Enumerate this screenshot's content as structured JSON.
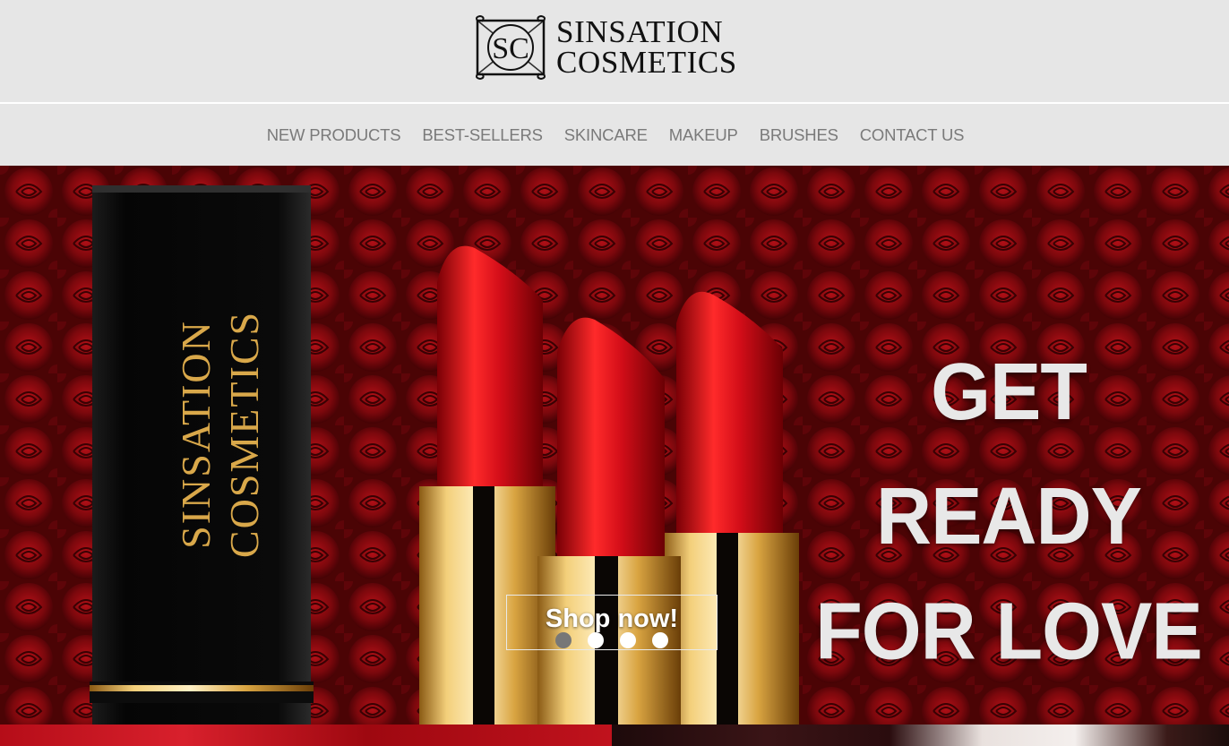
{
  "brand": {
    "monogram": "SC",
    "line1": "SINSATION",
    "line2": "COSMETICS"
  },
  "nav": {
    "items": [
      {
        "label": "NEW PRODUCTS"
      },
      {
        "label": "BEST-SELLERS"
      },
      {
        "label": "SKINCARE"
      },
      {
        "label": "MAKEUP"
      },
      {
        "label": "BRUSHES"
      },
      {
        "label": "CONTACT US"
      }
    ]
  },
  "hero": {
    "box_text_line1": "SINSATION",
    "box_text_line2": "COSMETICS",
    "headline_line1": "GET READY",
    "headline_line2": "FOR LOVE",
    "cta_label": "Shop now!",
    "slides_total": 4,
    "slide_active": 1
  },
  "colors": {
    "header_bg": "#e6e6e6",
    "nav_text": "#7a7a7a",
    "hero_red": "#8b0a10",
    "lipstick_red": "#d0101c",
    "gold": "#e8b44c",
    "dot_active": "#777777",
    "dot_inactive": "#ffffff"
  }
}
